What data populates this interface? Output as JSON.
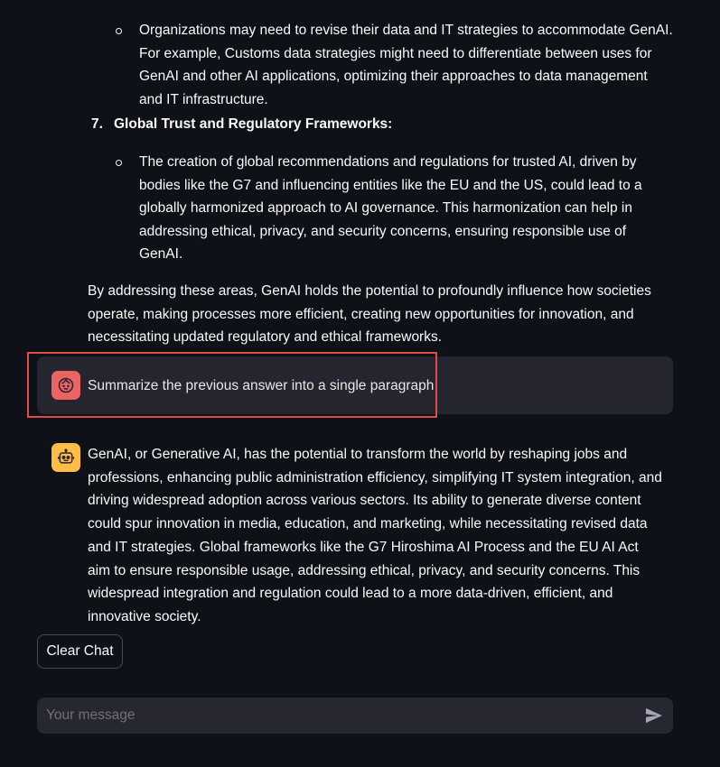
{
  "previous_answer": {
    "item6_bullet": "Organizations may need to revise their data and IT strategies to accommodate GenAI. For example, Customs data strategies might need to differentiate between uses for GenAI and other AI applications, optimizing their approaches to data management and IT infrastructure.",
    "item7": {
      "number": "7.",
      "title": "Global Trust and Regulatory Frameworks:",
      "bullet": "The creation of global recommendations and regulations for trusted AI, driven by bodies like the G7 and influencing entities like the EU and the US, could lead to a globally harmonized approach to AI governance. This harmonization can help in addressing ethical, privacy, and security concerns, ensuring responsible use of GenAI."
    },
    "conclusion": "By addressing these areas, GenAI holds the potential to profoundly influence how societies operate, making processes more efficient, creating new opportunities for innovation, and necessitating updated regulatory and ethical frameworks."
  },
  "user_message": {
    "text": "Summarize the previous answer into a single paragraph",
    "avatar_icon": "user-face-icon",
    "avatar_color": "#ff6b6b"
  },
  "assistant_message": {
    "text": "GenAI, or Generative AI, has the potential to transform the world by reshaping jobs and professions, enhancing public administration efficiency, simplifying IT system integration, and driving widespread adoption across various sectors. Its ability to generate diverse content could spur innovation in media, education, and marketing, while necessitating revised data and IT strategies. Global frameworks like the G7 Hiroshima AI Process and the EU AI Act aim to ensure responsible usage, addressing ethical, privacy, and security concerns. This widespread integration and regulation could lead to a more data-driven, efficient, and innovative society.",
    "avatar_icon": "robot-icon",
    "avatar_color": "#ffbd45"
  },
  "controls": {
    "clear_chat_label": "Clear Chat",
    "chat_placeholder": "Your message",
    "send_icon": "send-icon"
  },
  "colors": {
    "background": "#0e1117",
    "message_bg": "#262730",
    "highlight": "#e64a48"
  }
}
